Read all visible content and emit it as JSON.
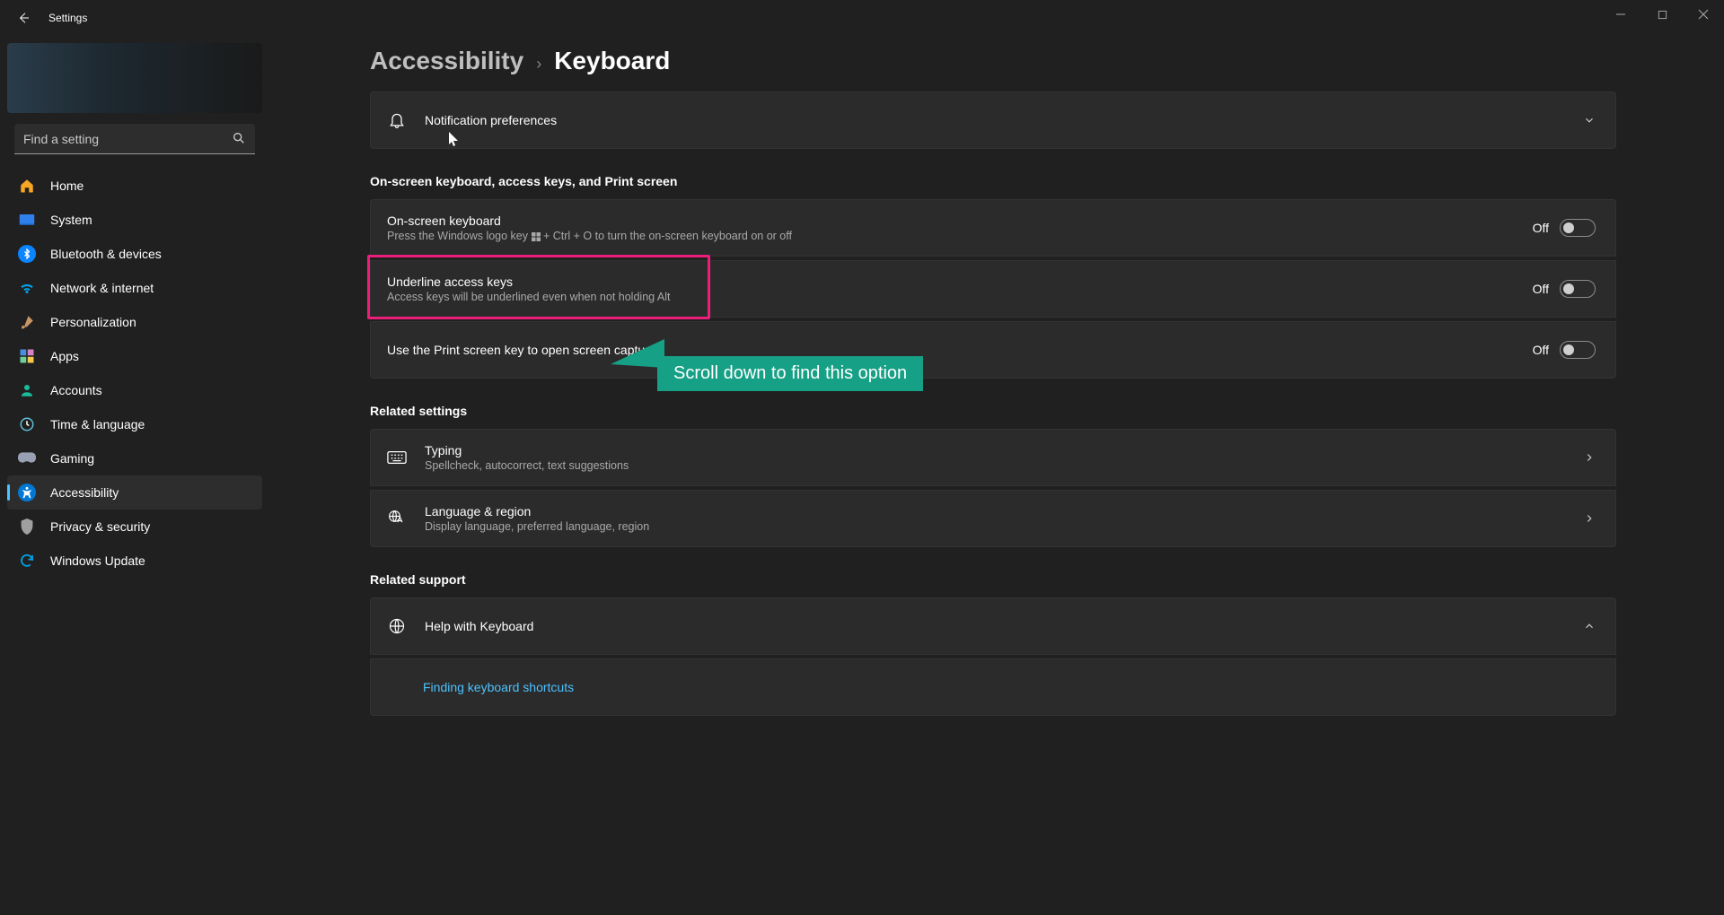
{
  "titlebar": {
    "title": "Settings"
  },
  "search": {
    "placeholder": "Find a setting"
  },
  "nav": {
    "home": "Home",
    "system": "System",
    "bluetooth": "Bluetooth & devices",
    "network": "Network & internet",
    "personalization": "Personalization",
    "apps": "Apps",
    "accounts": "Accounts",
    "time": "Time & language",
    "gaming": "Gaming",
    "accessibility": "Accessibility",
    "privacy": "Privacy & security",
    "update": "Windows Update"
  },
  "breadcrumb": {
    "parent": "Accessibility",
    "sep": "›",
    "current": "Keyboard"
  },
  "notif": {
    "title": "Notification preferences"
  },
  "group1": {
    "heading": "On-screen keyboard, access keys, and Print screen"
  },
  "osk": {
    "title": "On-screen keyboard",
    "sub_pre": "Press the Windows logo key ",
    "sub_post": " + Ctrl + O to turn the on-screen keyboard on or off",
    "state": "Off"
  },
  "uak": {
    "title": "Underline access keys",
    "sub": "Access keys will be underlined even when not holding Alt",
    "state": "Off"
  },
  "prtsc": {
    "title": "Use the Print screen key to open screen capture",
    "state": "Off"
  },
  "related": {
    "heading": "Related settings"
  },
  "typing": {
    "title": "Typing",
    "sub": "Spellcheck, autocorrect, text suggestions"
  },
  "lang": {
    "title": "Language & region",
    "sub": "Display language, preferred language, region"
  },
  "support": {
    "heading": "Related support"
  },
  "help": {
    "title": "Help with Keyboard"
  },
  "helplink": {
    "label": "Finding keyboard shortcuts"
  },
  "callout": {
    "text": "Scroll down to find this option"
  }
}
